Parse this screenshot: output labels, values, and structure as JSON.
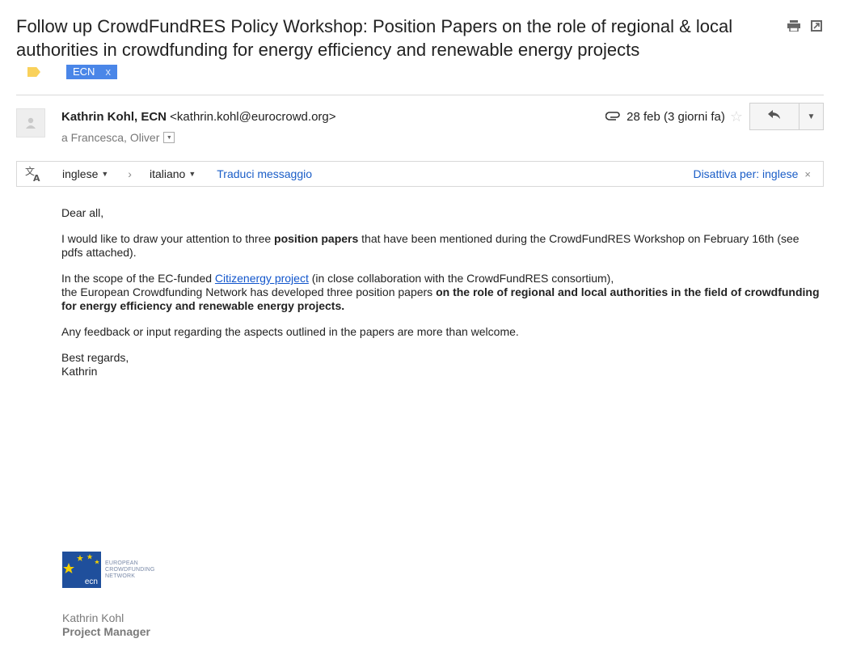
{
  "email": {
    "subject": "Follow up CrowdFundRES Policy Workshop: Position Papers on the role of regional & local authorities in crowdfunding for energy efficiency and renewable energy projects",
    "label_chip": {
      "name": "ECN",
      "remove": "x"
    },
    "sender": {
      "name": "Kathrin Kohl, ECN",
      "email": "<kathrin.kohl@eurocrowd.org>"
    },
    "recipients": "a Francesca, Oliver",
    "date": "28 feb (3 giorni fa)"
  },
  "translate": {
    "from": "inglese",
    "to": "italiano",
    "action": "Traduci messaggio",
    "disable": "Disattiva per: inglese",
    "close": "×"
  },
  "body": {
    "greeting": "Dear all,",
    "p1_a": "I would like to draw your attention to three ",
    "p1_b": "position papers",
    "p1_c": " that have been mentioned during the CrowdFundRES Workshop on February 16th (see pdfs attached).",
    "p2_a": "In the scope of the EC-funded ",
    "p2_link": "Citizenergy project",
    "p2_b": " (in close collaboration with the CrowdFundRES consortium),",
    "p2_c": "the European Crowdfunding Network has developed three position papers ",
    "p2_d": "on the role of regional and local authorities in the field of crowdfunding for energy efficiency and renewable energy projects.",
    "p3": "Any feedback or input regarding the aspects outlined in the papers are more than welcome.",
    "closing": "Best regards,",
    "closing_name": "Kathrin"
  },
  "signature": {
    "logo_mark": "ecn",
    "logo_line1": "EUROPEAN",
    "logo_line2": "CROWDFUNDING",
    "logo_line3": "NETWORK",
    "name": "Kathrin Kohl",
    "role": "Project Manager"
  },
  "icons": [
    "print-icon",
    "new-window-icon",
    "label-icon",
    "avatar-icon",
    "attachment-icon",
    "star-icon",
    "reply-icon",
    "more-icon",
    "translate-icon"
  ],
  "colors": {
    "label_chip": "#4a86e8",
    "label_tag": "#f9d15b",
    "link": "#1155cc",
    "logo": "#1f4f9c"
  }
}
